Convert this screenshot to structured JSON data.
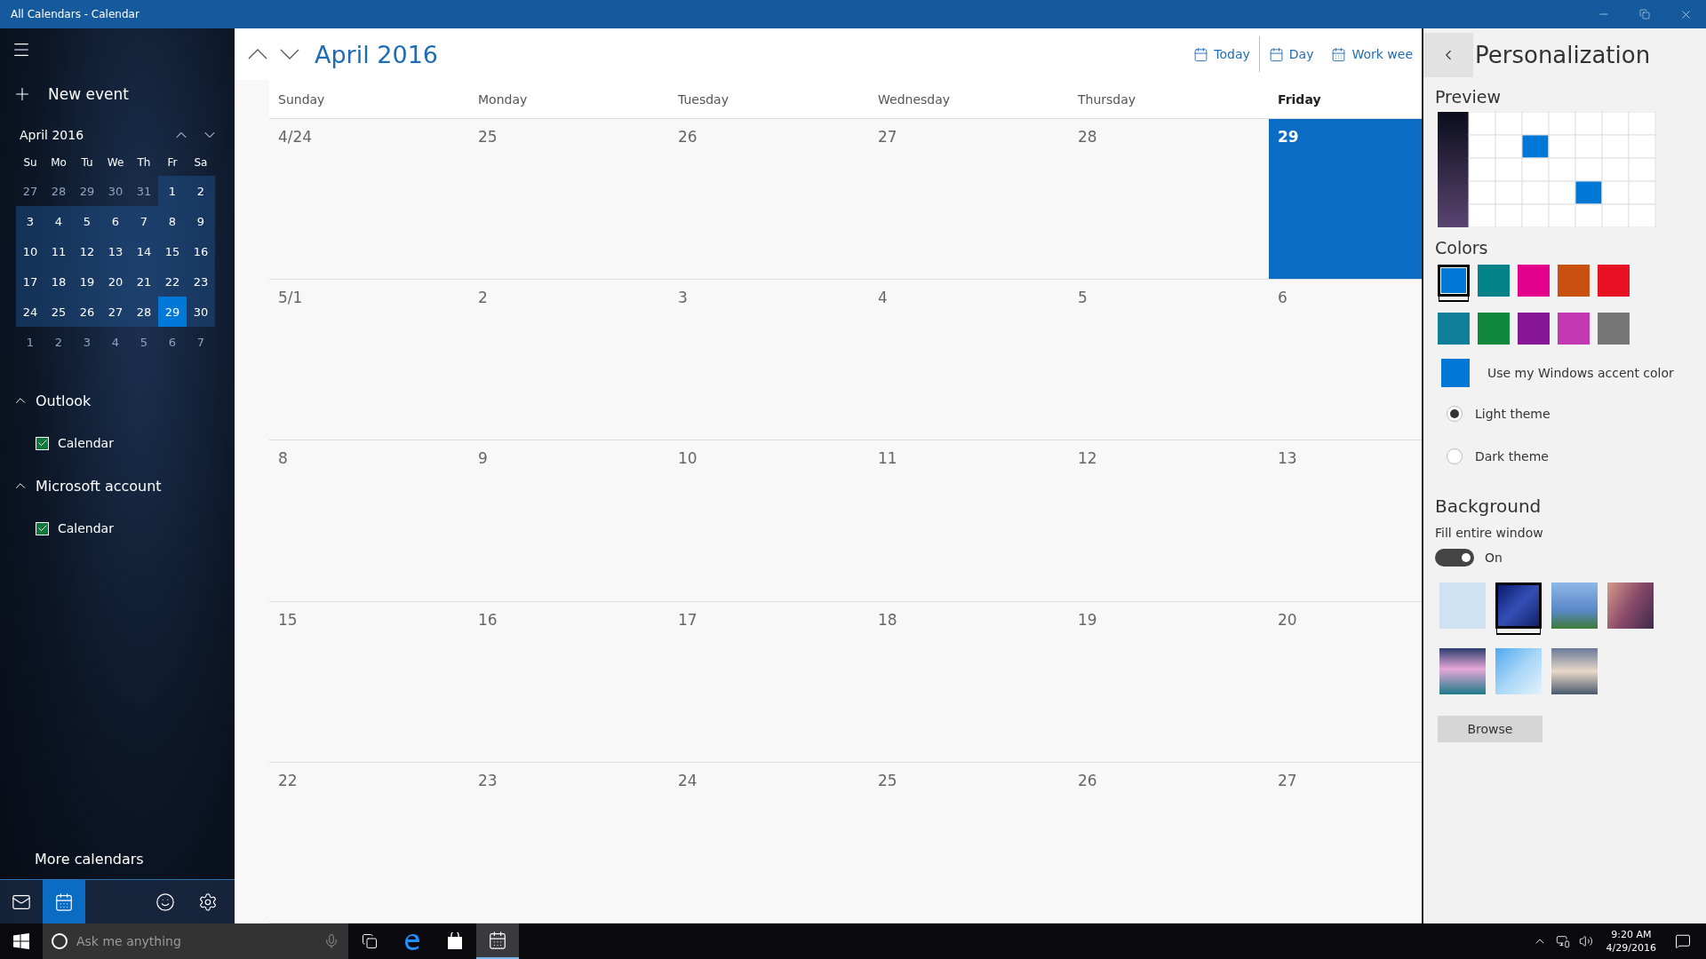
{
  "window": {
    "title": "All Calendars - Calendar"
  },
  "sidebar": {
    "new_event": "New event",
    "mini_calendar": {
      "title": "April 2016",
      "weekdays": [
        "Su",
        "Mo",
        "Tu",
        "We",
        "Th",
        "Fr",
        "Sa"
      ],
      "weeks": [
        [
          {
            "label": "27",
            "in_month": false,
            "selected": false
          },
          {
            "label": "28",
            "in_month": false,
            "selected": false
          },
          {
            "label": "29",
            "in_month": false,
            "selected": false
          },
          {
            "label": "30",
            "in_month": false,
            "selected": false
          },
          {
            "label": "31",
            "in_month": false,
            "selected": false
          },
          {
            "label": "1",
            "in_month": true,
            "selected": false
          },
          {
            "label": "2",
            "in_month": true,
            "selected": false
          }
        ],
        [
          {
            "label": "3",
            "in_month": true,
            "selected": false
          },
          {
            "label": "4",
            "in_month": true,
            "selected": false
          },
          {
            "label": "5",
            "in_month": true,
            "selected": false
          },
          {
            "label": "6",
            "in_month": true,
            "selected": false
          },
          {
            "label": "7",
            "in_month": true,
            "selected": false
          },
          {
            "label": "8",
            "in_month": true,
            "selected": false
          },
          {
            "label": "9",
            "in_month": true,
            "selected": false
          }
        ],
        [
          {
            "label": "10",
            "in_month": true,
            "selected": false
          },
          {
            "label": "11",
            "in_month": true,
            "selected": false
          },
          {
            "label": "12",
            "in_month": true,
            "selected": false
          },
          {
            "label": "13",
            "in_month": true,
            "selected": false
          },
          {
            "label": "14",
            "in_month": true,
            "selected": false
          },
          {
            "label": "15",
            "in_month": true,
            "selected": false
          },
          {
            "label": "16",
            "in_month": true,
            "selected": false
          }
        ],
        [
          {
            "label": "17",
            "in_month": true,
            "selected": false
          },
          {
            "label": "18",
            "in_month": true,
            "selected": false
          },
          {
            "label": "19",
            "in_month": true,
            "selected": false
          },
          {
            "label": "20",
            "in_month": true,
            "selected": false
          },
          {
            "label": "21",
            "in_month": true,
            "selected": false
          },
          {
            "label": "22",
            "in_month": true,
            "selected": false
          },
          {
            "label": "23",
            "in_month": true,
            "selected": false
          }
        ],
        [
          {
            "label": "24",
            "in_month": true,
            "selected": false
          },
          {
            "label": "25",
            "in_month": true,
            "selected": false
          },
          {
            "label": "26",
            "in_month": true,
            "selected": false
          },
          {
            "label": "27",
            "in_month": true,
            "selected": false
          },
          {
            "label": "28",
            "in_month": true,
            "selected": false
          },
          {
            "label": "29",
            "in_month": true,
            "selected": true
          },
          {
            "label": "30",
            "in_month": true,
            "selected": false
          }
        ],
        [
          {
            "label": "1",
            "in_month": false,
            "selected": false
          },
          {
            "label": "2",
            "in_month": false,
            "selected": false
          },
          {
            "label": "3",
            "in_month": false,
            "selected": false
          },
          {
            "label": "4",
            "in_month": false,
            "selected": false
          },
          {
            "label": "5",
            "in_month": false,
            "selected": false
          },
          {
            "label": "6",
            "in_month": false,
            "selected": false
          },
          {
            "label": "7",
            "in_month": false,
            "selected": false
          }
        ]
      ]
    },
    "accounts": [
      {
        "name": "Outlook",
        "expanded": true,
        "calendars": [
          {
            "label": "Calendar",
            "checked": true
          }
        ]
      },
      {
        "name": "Microsoft account",
        "expanded": true,
        "calendars": [
          {
            "label": "Calendar",
            "checked": true
          }
        ]
      }
    ],
    "more_calendars": "More calendars",
    "apps": [
      {
        "kind": "mail",
        "selected": false
      },
      {
        "kind": "calendar",
        "selected": true
      }
    ],
    "bottom_tools": [
      {
        "kind": "feedback"
      },
      {
        "kind": "settings"
      }
    ]
  },
  "toolbar": {
    "title": "April 2016",
    "views": [
      {
        "kind": "today",
        "label": "Today"
      },
      {
        "kind": "day",
        "label": "Day"
      },
      {
        "kind": "workweek",
        "label": "Work wee"
      }
    ]
  },
  "month": {
    "weekdays": [
      {
        "label": "Sunday",
        "selected": false
      },
      {
        "label": "Monday",
        "selected": false
      },
      {
        "label": "Tuesday",
        "selected": false
      },
      {
        "label": "Wednesday",
        "selected": false
      },
      {
        "label": "Thursday",
        "selected": false
      },
      {
        "label": "Friday",
        "selected": true
      }
    ],
    "weeks": [
      [
        {
          "label": "4/24",
          "today": false
        },
        {
          "label": "25",
          "today": false
        },
        {
          "label": "26",
          "today": false
        },
        {
          "label": "27",
          "today": false
        },
        {
          "label": "28",
          "today": false
        },
        {
          "label": "29",
          "today": true
        }
      ],
      [
        {
          "label": "5/1",
          "today": false
        },
        {
          "label": "2",
          "today": false
        },
        {
          "label": "3",
          "today": false
        },
        {
          "label": "4",
          "today": false
        },
        {
          "label": "5",
          "today": false
        },
        {
          "label": "6",
          "today": false
        }
      ],
      [
        {
          "label": "8",
          "today": false
        },
        {
          "label": "9",
          "today": false
        },
        {
          "label": "10",
          "today": false
        },
        {
          "label": "11",
          "today": false
        },
        {
          "label": "12",
          "today": false
        },
        {
          "label": "13",
          "today": false
        }
      ],
      [
        {
          "label": "15",
          "today": false
        },
        {
          "label": "16",
          "today": false
        },
        {
          "label": "17",
          "today": false
        },
        {
          "label": "18",
          "today": false
        },
        {
          "label": "19",
          "today": false
        },
        {
          "label": "20",
          "today": false
        }
      ],
      [
        {
          "label": "22",
          "today": false
        },
        {
          "label": "23",
          "today": false
        },
        {
          "label": "24",
          "today": false
        },
        {
          "label": "25",
          "today": false
        },
        {
          "label": "26",
          "today": false
        },
        {
          "label": "27",
          "today": false
        }
      ]
    ]
  },
  "personalization": {
    "title": "Personalization",
    "preview_heading": "Preview",
    "colors_heading": "Colors",
    "colors": [
      {
        "color": "#0078d7",
        "selected": true
      },
      {
        "color": "#038387",
        "selected": false
      },
      {
        "color": "#e3008c",
        "selected": false
      },
      {
        "color": "#ca5010",
        "selected": false
      },
      {
        "color": "#e81123",
        "selected": false
      },
      {
        "color": "#0f7f99",
        "selected": false
      },
      {
        "color": "#10893e",
        "selected": false
      },
      {
        "color": "#881798",
        "selected": false
      },
      {
        "color": "#c239b3",
        "selected": false
      },
      {
        "color": "#767676",
        "selected": false
      }
    ],
    "accent": {
      "label": "Use my Windows accent color",
      "color": "#0078d7"
    },
    "themes": [
      {
        "label": "Light theme",
        "selected": true
      },
      {
        "label": "Dark theme",
        "selected": false
      }
    ],
    "background_heading": "Background",
    "fill_label": "Fill entire window",
    "fill_on": true,
    "fill_state": "On",
    "backgrounds": [
      {
        "kind": "plain",
        "selected": false
      },
      {
        "kind": "stars",
        "selected": true
      },
      {
        "kind": "tree",
        "selected": false
      },
      {
        "kind": "canyon",
        "selected": false
      },
      {
        "kind": "hills",
        "selected": false
      },
      {
        "kind": "crystal",
        "selected": false
      },
      {
        "kind": "lake",
        "selected": false
      }
    ],
    "browse": "Browse"
  },
  "taskbar": {
    "search_placeholder": "Ask me anything",
    "time": "9:20 AM",
    "date": "4/29/2016"
  }
}
